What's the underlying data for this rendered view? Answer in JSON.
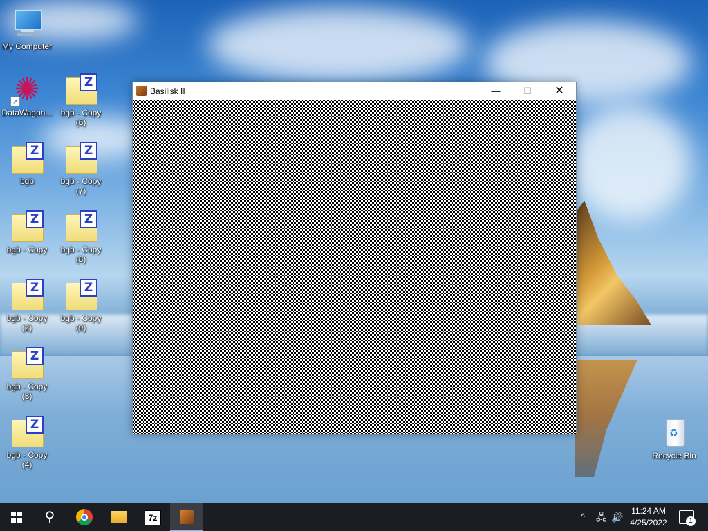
{
  "desktop": {
    "icons": {
      "my_computer": "My Computer",
      "datawagon": "DataWagon...",
      "bgb": "bgb",
      "bgb_copy": "bgb - Copy",
      "bgb_copy_2_l1": "bgb - Copy",
      "bgb_copy_2_l2": "(2)",
      "bgb_copy_3_l1": "bgb - Copy",
      "bgb_copy_3_l2": "(3)",
      "bgb_copy_4_l1": "bgb - Copy",
      "bgb_copy_4_l2": "(4)",
      "bgb_copy_6_l1": "bgb - Copy",
      "bgb_copy_6_l2": "(6)",
      "bgb_copy_7_l1": "bgb - Copy",
      "bgb_copy_7_l2": "(7)",
      "bgb_copy_8_l1": "bgb - Copy",
      "bgb_copy_8_l2": "(8)",
      "bgb_copy_9_l1": "bgb - Copy",
      "bgb_copy_9_l2": "(9)",
      "recycle_bin": "Recycle Bin"
    },
    "zbadge": "Z"
  },
  "window": {
    "title": "Basilisk II",
    "minimize": "—",
    "maximize": "☐",
    "close": "✕"
  },
  "taskbar": {
    "search_glyph": "⚲",
    "sevenzip_label": "7z",
    "tray_chevron": "^",
    "tray_network": "🖧",
    "tray_volume": "🔊",
    "clock_time": "11:24 AM",
    "clock_date": "4/25/2022",
    "notification_count": "1"
  },
  "icon_names": [
    "windows-icon",
    "search-icon",
    "chrome-icon",
    "file-explorer-icon",
    "7zip-icon",
    "basilisk-icon",
    "network-icon",
    "volume-icon",
    "notification-icon",
    "recycle-bin-icon",
    "computer-icon",
    "zfile-icon"
  ]
}
